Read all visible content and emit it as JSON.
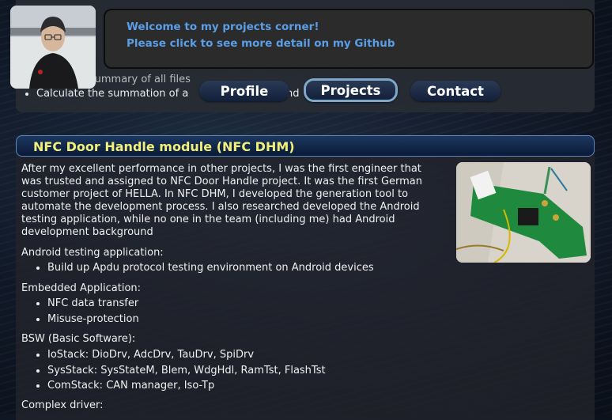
{
  "header": {
    "welcome_line1": "Welcome to my projects corner!",
    "welcome_line2": "Please click to see more detail on my Github",
    "peek_items": [
      "Summary of all files",
      "Calculate the summation of a",
      "and"
    ]
  },
  "nav": {
    "items": [
      {
        "label": "Profile",
        "active": false
      },
      {
        "label": "Projects",
        "active": true
      },
      {
        "label": "Contact",
        "active": false
      }
    ]
  },
  "section": {
    "title": "NFC Door Handle module (NFC DHM)",
    "paragraph": [
      "After my excellent performance in other projects, I was the first engineer that",
      "was trusted and assigned to NFC Door Handle project. It was the first German",
      "customer project of HELLA. In NFC DHM, I developed the generation tool to",
      "automate the development process. I also researched developed the Android",
      "testing application, while no one in the team (including me) had Android",
      "development background"
    ],
    "groups": [
      {
        "label": "Android testing application:",
        "items": [
          "Build up Apdu protocol testing environment on Android devices"
        ]
      },
      {
        "label": "Embedded Application:",
        "items": [
          "NFC data transfer",
          "Misuse-protection"
        ]
      },
      {
        "label": "BSW (Basic Software):",
        "items": [
          "IoStack: DioDrv, AdcDrv, TauDrv, SpiDrv",
          "SysStack: SysStateM, Blem, WdgHdl, RamTst, FlashTst",
          "ComStack: CAN manager, Iso-Tp"
        ]
      },
      {
        "label": "Complex driver:",
        "items": []
      }
    ]
  },
  "colors": {
    "title": "#f1f07a",
    "link": "#5b9ee8",
    "nav_bg": "#13203a"
  }
}
